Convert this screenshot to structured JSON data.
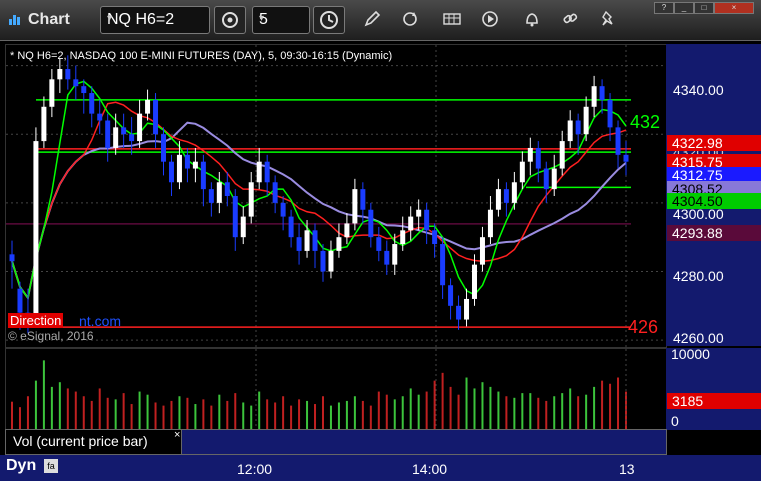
{
  "window": {
    "title": "Chart",
    "symbol": "NQ H6=2",
    "interval": "5",
    "controls": [
      "?",
      "_",
      "□",
      "×"
    ]
  },
  "chart": {
    "header": "* NQ H6=2, NASDAQ 100 E-MINI FUTURES (DAY), 5, 09:30-16:15 (Dynamic)",
    "copyright": "© eSignal, 2016",
    "watermark_red": "Direction",
    "watermark_blue": "nt.com",
    "price_ticks": [
      "4340.00",
      "4320.00",
      "4300.00",
      "4280.00",
      "4260.00"
    ],
    "price_tags": [
      {
        "text": "4322.98",
        "bg": "#e00000"
      },
      {
        "text": "4315.75",
        "bg": "#e00000"
      },
      {
        "text": "4312.75",
        "bg": "#1a1aff"
      },
      {
        "text": "4308.52",
        "bg": "#8878d8"
      },
      {
        "text": "4304.50",
        "bg": "#00cc00"
      },
      {
        "text": "4293.88",
        "bg": "#5a0a3a"
      }
    ],
    "line_labels": {
      "green": "432",
      "red": "426"
    },
    "colors": {
      "up": "#ffffff",
      "down": "#1a3cff",
      "green_line": "#00ff00",
      "red_line": "#ff2020",
      "purple_line": "#9a8ce0"
    }
  },
  "chart_data": {
    "type": "candlestick",
    "x_tick_labels": [
      "12:00",
      "14:00",
      "13"
    ],
    "y_tick_labels": [
      "4340.00",
      "4320.00",
      "4300.00",
      "4280.00",
      "4260.00"
    ],
    "ylim": [
      4258,
      4346
    ],
    "horizontal_levels": [
      {
        "value": 4330.0,
        "color": "green"
      },
      {
        "value": 4314.8,
        "color": "green"
      },
      {
        "value": 4315.75,
        "color": "red"
      },
      {
        "value": 4304.5,
        "color": "green"
      },
      {
        "value": 4263.8,
        "color": "red"
      },
      {
        "value": 4293.88,
        "color": "purple"
      }
    ],
    "candles": [
      [
        4285,
        4283,
        4289,
        4275
      ],
      [
        4275,
        4268,
        4277,
        4263
      ],
      [
        4268,
        4266,
        4275,
        4262
      ],
      [
        4266,
        4318,
        4322,
        4265
      ],
      [
        4318,
        4328,
        4331,
        4316
      ],
      [
        4328,
        4336,
        4339,
        4325
      ],
      [
        4336,
        4339,
        4342,
        4332
      ],
      [
        4339,
        4336,
        4343,
        4333
      ],
      [
        4336,
        4334,
        4340,
        4330
      ],
      [
        4334,
        4332,
        4336,
        4326
      ],
      [
        4332,
        4326,
        4334,
        4322
      ],
      [
        4326,
        4324,
        4330,
        4320
      ],
      [
        4324,
        4316,
        4326,
        4312
      ],
      [
        4316,
        4322,
        4326,
        4314
      ],
      [
        4322,
        4320,
        4326,
        4316
      ],
      [
        4320,
        4318,
        4325,
        4314
      ],
      [
        4318,
        4326,
        4330,
        4316
      ],
      [
        4326,
        4330,
        4333,
        4324
      ],
      [
        4330,
        4320,
        4332,
        4316
      ],
      [
        4320,
        4312,
        4322,
        4308
      ],
      [
        4312,
        4306,
        4314,
        4302
      ],
      [
        4306,
        4314,
        4318,
        4304
      ],
      [
        4314,
        4310,
        4316,
        4306
      ],
      [
        4310,
        4312,
        4316,
        4306
      ],
      [
        4312,
        4304,
        4314,
        4299
      ],
      [
        4304,
        4300,
        4306,
        4296
      ],
      [
        4300,
        4306,
        4309,
        4297
      ],
      [
        4306,
        4302,
        4309,
        4299
      ],
      [
        4302,
        4290,
        4304,
        4286
      ],
      [
        4290,
        4296,
        4299,
        4288
      ],
      [
        4296,
        4306,
        4309,
        4294
      ],
      [
        4306,
        4312,
        4316,
        4304
      ],
      [
        4312,
        4306,
        4314,
        4302
      ],
      [
        4306,
        4300,
        4308,
        4297
      ],
      [
        4300,
        4296,
        4302,
        4292
      ],
      [
        4296,
        4290,
        4298,
        4287
      ],
      [
        4290,
        4286,
        4294,
        4282
      ],
      [
        4286,
        4292,
        4295,
        4284
      ],
      [
        4292,
        4286,
        4294,
        4281
      ],
      [
        4286,
        4280,
        4288,
        4277
      ],
      [
        4280,
        4286,
        4289,
        4278
      ],
      [
        4286,
        4290,
        4294,
        4284
      ],
      [
        4290,
        4294,
        4297,
        4288
      ],
      [
        4294,
        4304,
        4307,
        4292
      ],
      [
        4304,
        4298,
        4306,
        4294
      ],
      [
        4298,
        4290,
        4300,
        4287
      ],
      [
        4290,
        4286,
        4293,
        4283
      ],
      [
        4286,
        4282,
        4289,
        4279
      ],
      [
        4282,
        4288,
        4291,
        4279
      ],
      [
        4288,
        4292,
        4296,
        4286
      ],
      [
        4292,
        4296,
        4299,
        4289
      ],
      [
        4296,
        4298,
        4301,
        4292
      ],
      [
        4298,
        4292,
        4300,
        4288
      ],
      [
        4292,
        4288,
        4294,
        4284
      ],
      [
        4288,
        4276,
        4290,
        4272
      ],
      [
        4276,
        4270,
        4278,
        4266
      ],
      [
        4270,
        4266,
        4273,
        4263
      ],
      [
        4266,
        4272,
        4275,
        4264
      ],
      [
        4272,
        4282,
        4285,
        4270
      ],
      [
        4282,
        4290,
        4293,
        4280
      ],
      [
        4290,
        4298,
        4302,
        4288
      ],
      [
        4298,
        4304,
        4307,
        4296
      ],
      [
        4304,
        4300,
        4306,
        4296
      ],
      [
        4300,
        4306,
        4309,
        4298
      ],
      [
        4306,
        4312,
        4315,
        4304
      ],
      [
        4312,
        4316,
        4319,
        4308
      ],
      [
        4316,
        4310,
        4318,
        4306
      ],
      [
        4310,
        4304,
        4312,
        4300
      ],
      [
        4304,
        4310,
        4314,
        4302
      ],
      [
        4310,
        4318,
        4321,
        4308
      ],
      [
        4318,
        4324,
        4327,
        4316
      ],
      [
        4324,
        4320,
        4326,
        4314
      ],
      [
        4320,
        4328,
        4331,
        4318
      ],
      [
        4328,
        4334,
        4337,
        4325
      ],
      [
        4334,
        4330,
        4336,
        4326
      ],
      [
        4330,
        4322,
        4332,
        4318
      ],
      [
        4322,
        4314,
        4324,
        4310
      ],
      [
        4314,
        4312,
        4318,
        4308
      ]
    ],
    "volume_ticks": [
      "10000",
      "0"
    ],
    "volume_last": "3185"
  },
  "volume": {
    "label": "Vol (current price bar)",
    "close": "×",
    "tag": "3185",
    "ticks": [
      "10000",
      "0"
    ],
    "max": 10000,
    "values": [
      3500,
      2800,
      4200,
      6200,
      8800,
      5400,
      6000,
      5200,
      4800,
      4200,
      3600,
      5200,
      4000,
      3800,
      4600,
      3200,
      4800,
      4400,
      3400,
      3000,
      3600,
      4200,
      4000,
      3200,
      3800,
      3000,
      4400,
      3600,
      4600,
      3400,
      3000,
      4800,
      3800,
      3400,
      4200,
      3000,
      3800,
      3600,
      3200,
      4200,
      3000,
      3400,
      3600,
      4200,
      3600,
      3000,
      4800,
      4400,
      3800,
      4200,
      5200,
      4400,
      4800,
      6200,
      7200,
      5400,
      4400,
      6600,
      5200,
      6000,
      5400,
      4800,
      4200,
      4000,
      4600,
      4600,
      4000,
      3600,
      4200,
      4600,
      5200,
      4200,
      4400,
      5400,
      6200,
      5800,
      6600,
      4800
    ]
  },
  "bottombar": {
    "mode": "Dyn",
    "time_labels": [
      "12:00",
      "14:00",
      "13"
    ]
  }
}
